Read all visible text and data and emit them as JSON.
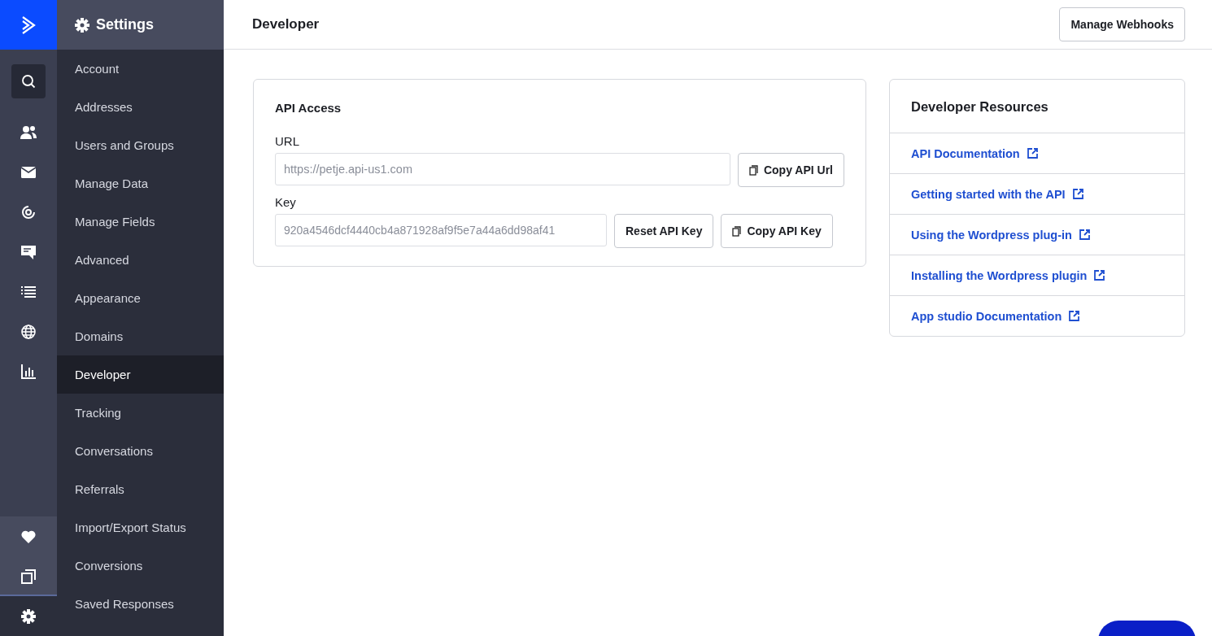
{
  "rail": {
    "top_items": [
      {
        "kind": "search",
        "selected": false
      },
      {
        "kind": "contacts",
        "selected": false
      },
      {
        "kind": "mail",
        "selected": false
      },
      {
        "kind": "target",
        "selected": false
      },
      {
        "kind": "chat",
        "selected": false
      },
      {
        "kind": "list",
        "selected": false
      },
      {
        "kind": "globe",
        "selected": false
      },
      {
        "kind": "chart",
        "selected": false
      }
    ],
    "bottom_items": [
      {
        "kind": "heart",
        "selected": false
      },
      {
        "kind": "copy",
        "selected": false
      },
      {
        "kind": "gear",
        "selected": true
      }
    ]
  },
  "sidebar": {
    "title": "Settings",
    "items": [
      {
        "label": "Account",
        "selected": false
      },
      {
        "label": "Addresses",
        "selected": false
      },
      {
        "label": "Users and Groups",
        "selected": false
      },
      {
        "label": "Manage Data",
        "selected": false
      },
      {
        "label": "Manage Fields",
        "selected": false
      },
      {
        "label": "Advanced",
        "selected": false
      },
      {
        "label": "Appearance",
        "selected": false
      },
      {
        "label": "Domains",
        "selected": false
      },
      {
        "label": "Developer",
        "selected": true
      },
      {
        "label": "Tracking",
        "selected": false
      },
      {
        "label": "Conversations",
        "selected": false
      },
      {
        "label": "Referrals",
        "selected": false
      },
      {
        "label": "Import/Export Status",
        "selected": false
      },
      {
        "label": "Conversions",
        "selected": false
      },
      {
        "label": "Saved Responses",
        "selected": false
      }
    ]
  },
  "header": {
    "title": "Developer",
    "button": "Manage Webhooks"
  },
  "api_access": {
    "title": "API Access",
    "url": {
      "label": "URL",
      "value": "https://petje.api-us1.com",
      "copy_button": "Copy API Url"
    },
    "key": {
      "label": "Key",
      "value": "920a4546dcf4440cb4a871928af9f5e7a44a6dd98af41",
      "reset_button": "Reset API Key",
      "copy_button": "Copy API Key"
    }
  },
  "resources": {
    "title": "Developer Resources",
    "links": [
      "API Documentation",
      "Getting started with the API",
      "Using the Wordpress plug-in",
      "Installing the Wordpress plugin",
      "App studio Documentation"
    ]
  }
}
